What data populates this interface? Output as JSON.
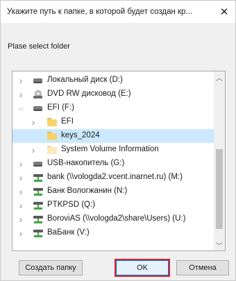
{
  "dialog": {
    "title": "Укажите путь к папке, в которой будет создан кр...",
    "prompt": "Plase select folder"
  },
  "tree": {
    "items": [
      {
        "label": "Локальный диск (D:)",
        "icon": "drive-icon",
        "expander": "collapsed",
        "level": 0
      },
      {
        "label": "DVD RW дисковод (E:)",
        "icon": "dvd-drive-icon",
        "expander": "collapsed",
        "level": 0
      },
      {
        "label": "EFI (F:)",
        "icon": "drive-icon",
        "expander": "expanded",
        "level": 0
      },
      {
        "label": "EFI",
        "icon": "folder-icon",
        "expander": "collapsed",
        "level": 1
      },
      {
        "label": "keys_2024",
        "icon": "folder-icon",
        "expander": "none",
        "level": 1,
        "selected": true
      },
      {
        "label": "System Volume Information",
        "icon": "folder-pale-icon",
        "expander": "collapsed",
        "level": 1
      },
      {
        "label": "USB-накопитель (G:)",
        "icon": "drive-icon",
        "expander": "collapsed",
        "level": 0
      },
      {
        "label": "bank (\\\\vologda2.vcent.inarnet.ru) (M:)",
        "icon": "network-drive-icon",
        "expander": "collapsed",
        "level": 0
      },
      {
        "label": "Банк Вологжанин (N:)",
        "icon": "network-drive-icon",
        "expander": "collapsed",
        "level": 0
      },
      {
        "label": "PTKPSD (Q:)",
        "icon": "network-drive-icon",
        "expander": "collapsed",
        "level": 0
      },
      {
        "label": "BoroviAS (\\\\vologda2\\share\\Users) (U:)",
        "icon": "network-drive-icon",
        "expander": "collapsed",
        "level": 0
      },
      {
        "label": "ВаБанк (V:)",
        "icon": "network-drive-icon",
        "expander": "collapsed",
        "level": 0
      }
    ]
  },
  "buttons": {
    "new_folder": "Создать папку",
    "ok": "OK",
    "cancel": "Отмена"
  },
  "colors": {
    "selection": "#cce8ff",
    "highlight_border": "#d9232e",
    "folder": "#f6d36b",
    "network_drive": "#3fa63f"
  }
}
